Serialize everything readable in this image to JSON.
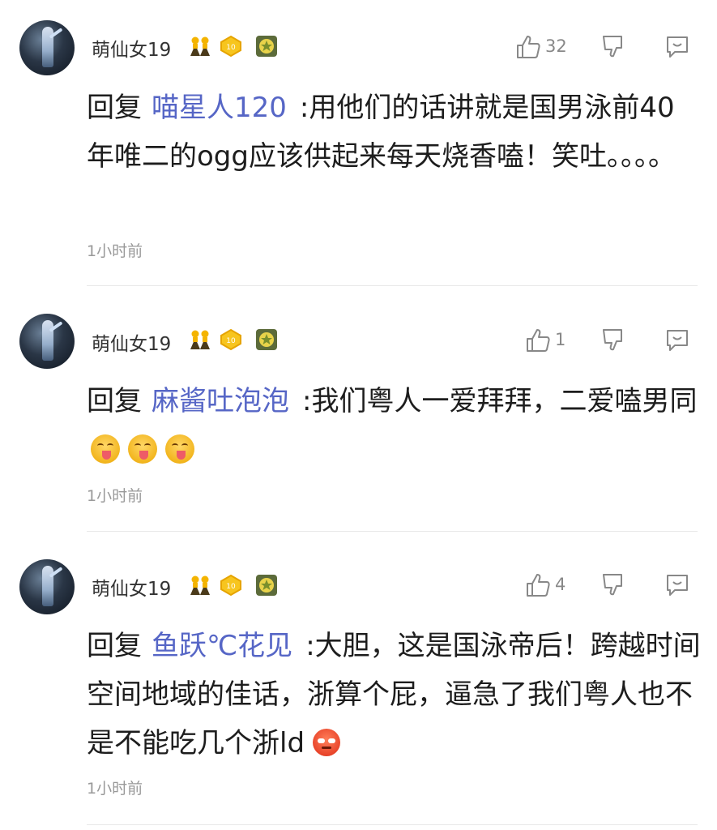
{
  "comments": [
    {
      "username": "萌仙女19",
      "likes": "32",
      "reply_prefix": "回复",
      "reply_target": "喵星人120",
      "text": ":用他们的话讲就是国男泳前40年唯二的ogg应该供起来每天烧香嗑！笑吐。。。。",
      "time": "1小时前",
      "trailing_emoji": null
    },
    {
      "username": "萌仙女19",
      "likes": "1",
      "reply_prefix": "回复",
      "reply_target": "麻酱吐泡泡",
      "text": ":我们粤人一爱拜拜，二爱嗑男同",
      "time": "1小时前",
      "trailing_emoji": "yum-emoji x3"
    },
    {
      "username": "萌仙女19",
      "likes": "4",
      "reply_prefix": "回复",
      "reply_target": "鱼跃℃花见",
      "text": ":大胆，这是国泳帝后！跨越时间空间地域的佳话，浙算个屁，逼急了我们粤人也不是不能吃几个浙ld",
      "time": "1小时前",
      "trailing_emoji": "angry-emoji"
    }
  ],
  "badges": {
    "level": "10"
  },
  "icons": {
    "like": "thumbs-up-icon",
    "dislike": "thumbs-down-icon",
    "reply": "comment-bubble-icon",
    "user_badge": "twin-figures-icon",
    "level_badge": "level-coin-icon",
    "honor_badge": "hexagon-star-icon"
  },
  "colors": {
    "reply_target": "#5666c6",
    "text": "#1d1d1d",
    "meta": "#999999",
    "icon": "#888888"
  }
}
